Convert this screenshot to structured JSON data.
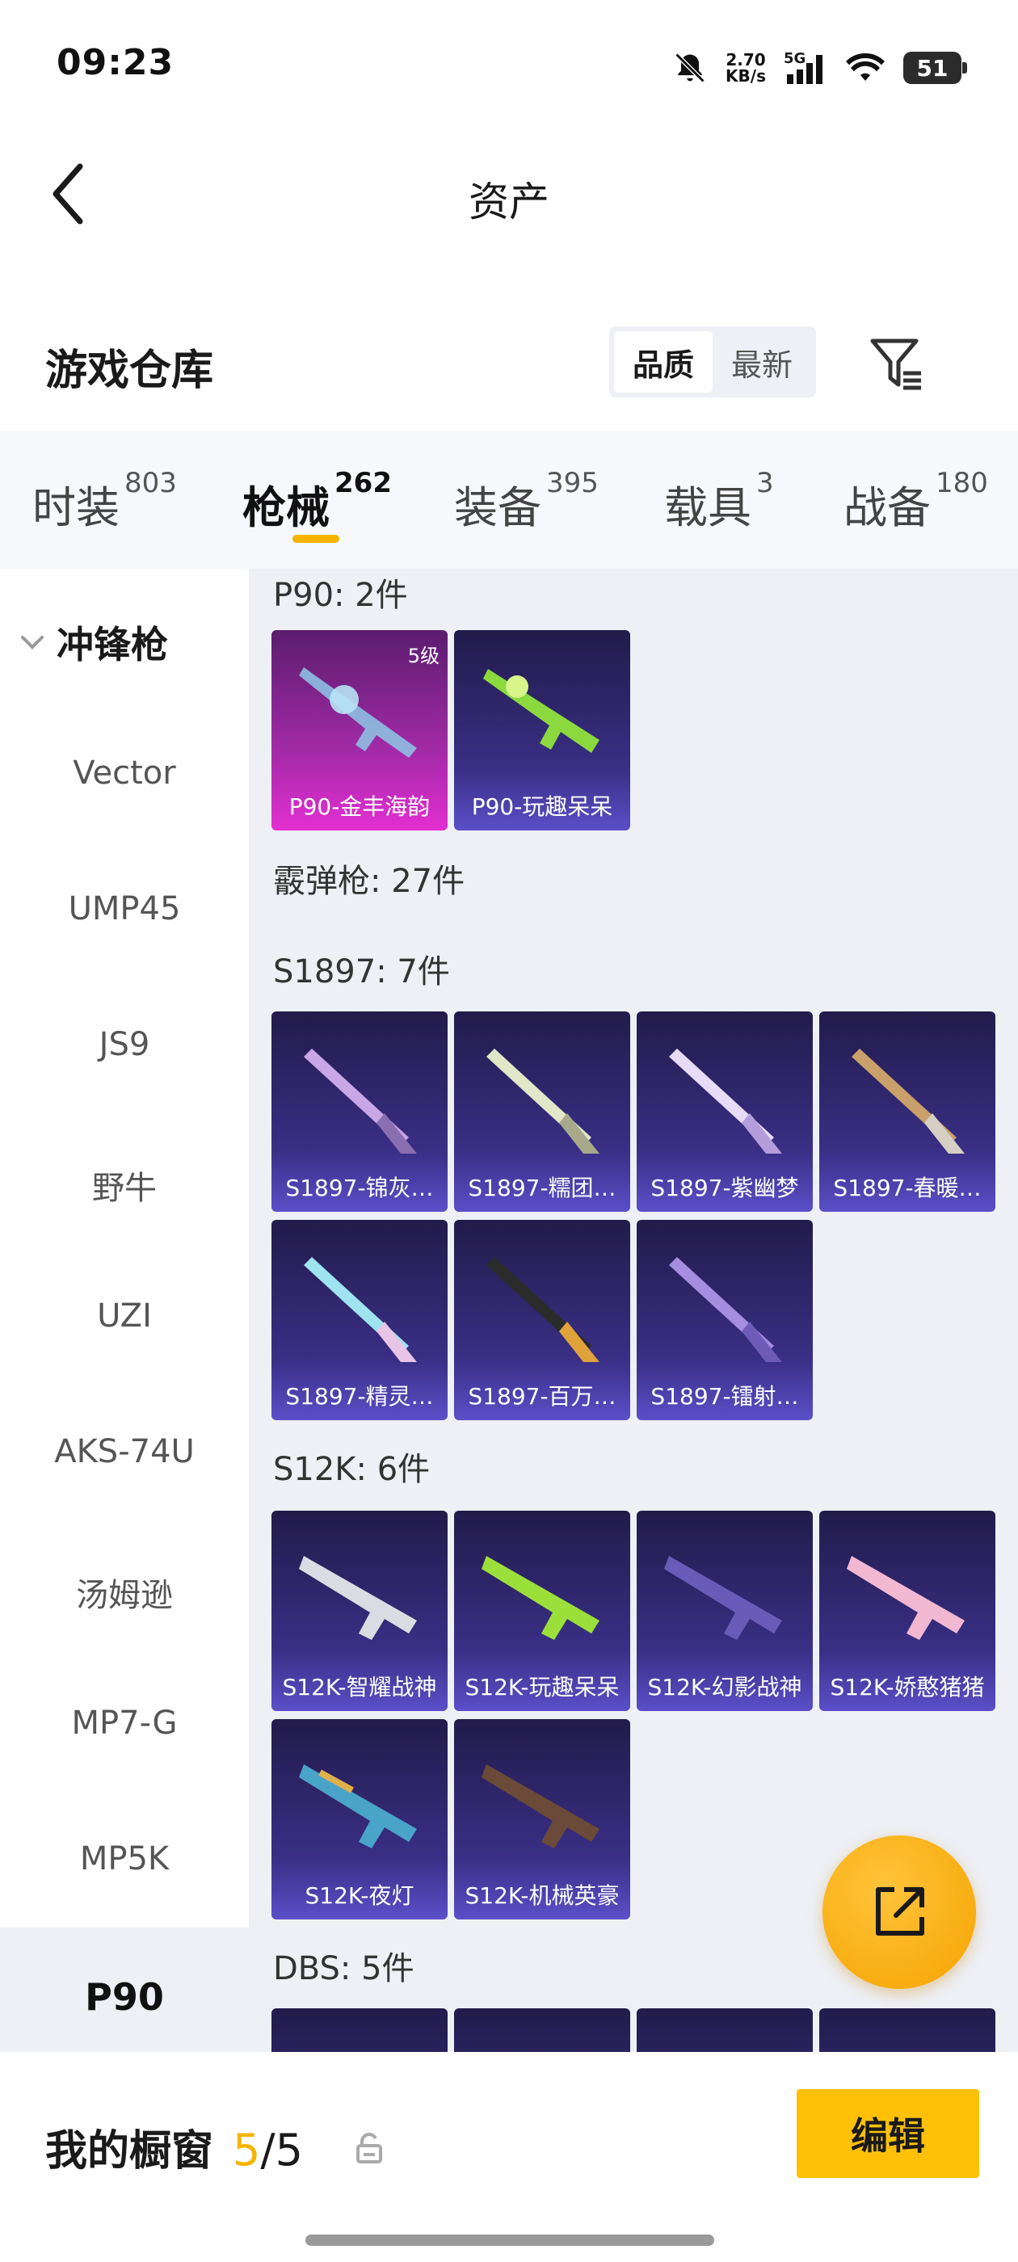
{
  "status": {
    "time": "09:23",
    "net_speed_value": "2.70",
    "net_speed_unit": "KB/s",
    "network_type": "5G",
    "battery": "51"
  },
  "header": {
    "title": "资产",
    "back_icon": "chevron-left-icon"
  },
  "warehouse": {
    "title": "游戏仓库",
    "sort_options": [
      "品质",
      "最新"
    ],
    "sort_active": "品质",
    "filter_icon": "filter-icon"
  },
  "tabs": [
    {
      "label": "时装",
      "count": "803"
    },
    {
      "label": "枪械",
      "count": "262"
    },
    {
      "label": "装备",
      "count": "395"
    },
    {
      "label": "载具",
      "count": "3"
    },
    {
      "label": "战备",
      "count": "180"
    }
  ],
  "active_tab": "枪械",
  "sidebar": {
    "group": "冲锋枪",
    "items": [
      "Vector",
      "UMP45",
      "JS9",
      "野牛",
      "UZI",
      "AKS-74U",
      "汤姆逊",
      "MP7-G",
      "MP5K",
      "P90"
    ],
    "active": "P90"
  },
  "sections": {
    "p90": {
      "title": "P90: 2件",
      "items": [
        "P90-金丰海韵",
        "P90-玩趣呆呆"
      ],
      "level_badge": "5级"
    },
    "shotgun": {
      "title": "霰弹枪: 27件"
    },
    "s1897": {
      "title": "S1897: 7件",
      "items": [
        "S1897-锦灰…",
        "S1897-糯团…",
        "S1897-紫幽梦",
        "S1897-春暖…",
        "S1897-精灵…",
        "S1897-百万…",
        "S1897-镭射…"
      ]
    },
    "s12k": {
      "title": "S12K: 6件",
      "items": [
        "S12K-智耀战神",
        "S12K-玩趣呆呆",
        "S12K-幻影战神",
        "S12K-娇憨猪猪",
        "S12K-夜灯",
        "S12K-机械英豪"
      ]
    },
    "dbs": {
      "title": "DBS: 5件"
    }
  },
  "fab_icon": "share-icon",
  "bottom": {
    "showcase_label": "我的橱窗",
    "showcase_current": "5",
    "showcase_sep": "/",
    "showcase_total": "5",
    "lock_icon": "unlock-icon",
    "edit_label": "编辑"
  },
  "colors": {
    "accent": "#f6b400",
    "button": "#ffc107",
    "card_purple": "#3a2f86",
    "card_gold": "#e32fd2"
  }
}
